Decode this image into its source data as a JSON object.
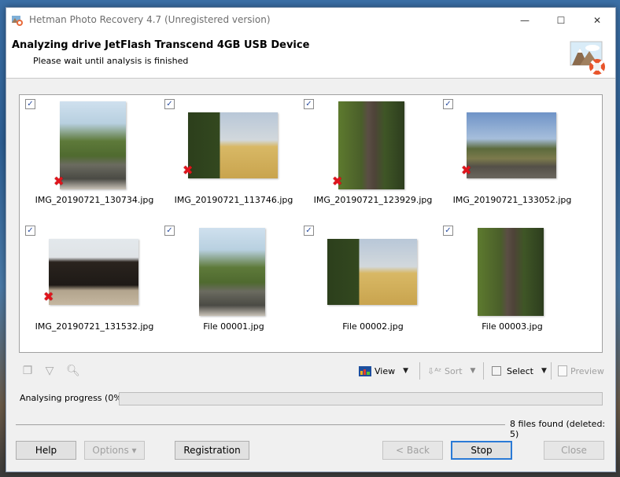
{
  "window": {
    "title": "Hetman Photo Recovery 4.7 (Unregistered version)",
    "controls": {
      "minimize": "—",
      "maximize": "☐",
      "close": "✕"
    }
  },
  "header": {
    "title": "Analyzing drive JetFlash Transcend 4GB USB Device",
    "subtitle": "Please wait until analysis is finished"
  },
  "files": [
    {
      "name": "IMG_20190721_130734.jpg",
      "checked": true,
      "deleted": true,
      "orientation": "portrait",
      "scene": "cross-monument"
    },
    {
      "name": "IMG_20190721_113746.jpg",
      "checked": true,
      "deleted": true,
      "orientation": "landscape",
      "scene": "watchtower-field"
    },
    {
      "name": "IMG_20190721_123929.jpg",
      "checked": true,
      "deleted": true,
      "orientation": "portrait",
      "scene": "old-tree"
    },
    {
      "name": "IMG_20190721_133052.jpg",
      "checked": true,
      "deleted": true,
      "orientation": "landscape",
      "scene": "monument-meadow"
    },
    {
      "name": "IMG_20190721_131532.jpg",
      "checked": true,
      "deleted": true,
      "orientation": "landscape",
      "scene": "wooden-church"
    },
    {
      "name": "File 00001.jpg",
      "checked": true,
      "deleted": false,
      "orientation": "portrait",
      "scene": "cross-monument"
    },
    {
      "name": "File 00002.jpg",
      "checked": true,
      "deleted": false,
      "orientation": "landscape",
      "scene": "watchtower-field"
    },
    {
      "name": "File 00003.jpg",
      "checked": true,
      "deleted": false,
      "orientation": "portrait",
      "scene": "old-tree"
    }
  ],
  "toolbar": {
    "left_icons": [
      "copy-icon",
      "filter-icon",
      "find-icon"
    ],
    "view_label": "View",
    "sort_label": "Sort",
    "select_label": "Select",
    "preview_label": "Preview"
  },
  "progress": {
    "label": "Analysing progress (0%)",
    "percent": 0
  },
  "status": {
    "found": "8 files found (deleted: 5)"
  },
  "buttons": {
    "help": "Help",
    "options": "Options ▾",
    "registration": "Registration",
    "back": "< Back",
    "stop": "Stop",
    "close": "Close"
  },
  "colors": {
    "accent": "#2a7ad6",
    "deleted_mark": "#e0141c",
    "check": "#2a4da0"
  }
}
